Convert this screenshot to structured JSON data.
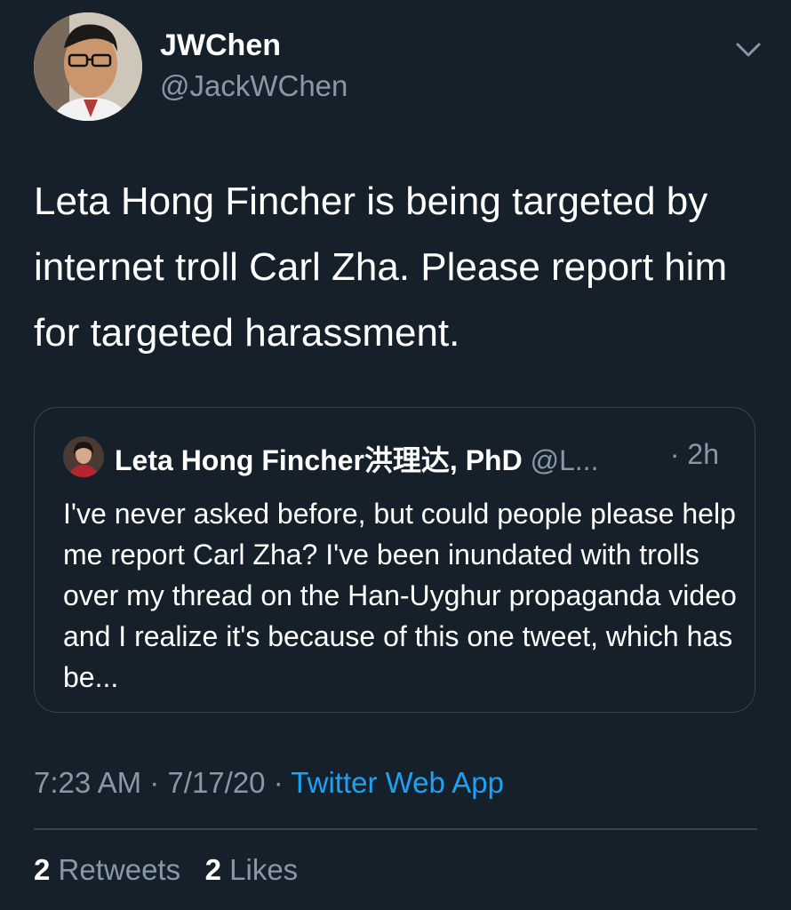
{
  "author": {
    "display_name": "JWChen",
    "handle": "@JackWChen"
  },
  "menu_icon": "chevron-down-icon",
  "tweet": {
    "text": "Leta Hong Fincher is being targeted by internet troll Carl Zha. Please report him for targeted harassment."
  },
  "quoted_tweet": {
    "author_name": "Leta Hong Fincher洪理达, PhD",
    "author_handle": "@L...",
    "time": "· 2h",
    "text": "I've never asked before, but could people please help me report Carl Zha? I've been inundated with trolls over my thread on the Han-Uyghur propaganda video and I realize it's because of this one tweet, which has be..."
  },
  "meta": {
    "time": "7:23 AM",
    "sep1": "·",
    "date": "7/17/20",
    "sep2": "·",
    "source": "Twitter Web App"
  },
  "stats": {
    "retweets_count": "2",
    "retweets_label": "Retweets",
    "likes_count": "2",
    "likes_label": "Likes"
  },
  "colors": {
    "background": "#15202b",
    "secondary_text": "#8899a6",
    "link": "#1da1f2",
    "border": "#38444d"
  }
}
